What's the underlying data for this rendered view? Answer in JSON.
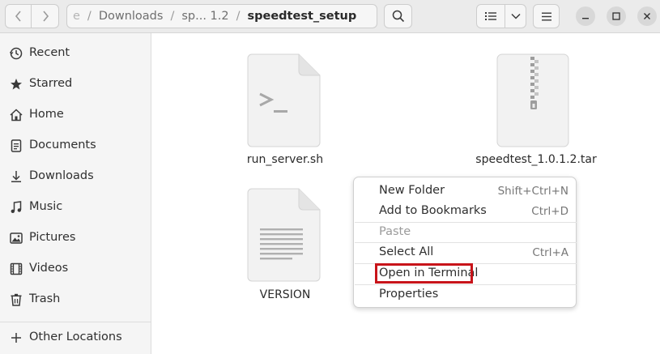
{
  "header": {
    "path": {
      "crumbs": [
        "e",
        "Downloads",
        "sp... 1.2",
        "speedtest_setup"
      ],
      "separator": "/"
    },
    "icons": {
      "back": "chevron-left-icon",
      "forward": "chevron-right-icon",
      "path_menu": "vertical-dots-icon",
      "search": "search-icon",
      "list_view": "list-view-icon",
      "view_options": "chevron-down-icon",
      "main_menu": "hamburger-menu-icon",
      "minimize": "minimize-icon",
      "maximize": "maximize-icon",
      "close": "close-icon"
    }
  },
  "sidebar": {
    "items": [
      {
        "label": "Recent",
        "icon": "clock-icon"
      },
      {
        "label": "Starred",
        "icon": "star-icon"
      },
      {
        "label": "Home",
        "icon": "home-icon"
      },
      {
        "label": "Documents",
        "icon": "document-icon"
      },
      {
        "label": "Downloads",
        "icon": "download-icon"
      },
      {
        "label": "Music",
        "icon": "music-note-icon"
      },
      {
        "label": "Pictures",
        "icon": "picture-icon"
      },
      {
        "label": "Videos",
        "icon": "film-icon"
      },
      {
        "label": "Trash",
        "icon": "trash-icon"
      }
    ],
    "other_locations": {
      "label": "Other Locations",
      "icon": "plus-icon"
    }
  },
  "files": [
    {
      "name": "run_server.sh",
      "icon": "shell-script-icon"
    },
    {
      "name": "speedtest_1.0.1.2.tar",
      "icon": "archive-icon"
    },
    {
      "name": "VERSION",
      "icon": "text-file-icon"
    }
  ],
  "context_menu": {
    "items": [
      {
        "label": "New Folder",
        "shortcut": "Shift+Ctrl+N"
      },
      {
        "label": "Add to Bookmarks",
        "shortcut": "Ctrl+D"
      },
      {
        "label": "Paste",
        "shortcut": "",
        "disabled": true
      },
      {
        "label": "Select All",
        "shortcut": "Ctrl+A"
      },
      {
        "label": "Open in Terminal",
        "shortcut": "",
        "highlighted": true
      },
      {
        "label": "Properties",
        "shortcut": ""
      }
    ]
  },
  "colors": {
    "highlight_box": "#c8141a",
    "header_bg": "#ebebeb",
    "sidebar_bg": "#f5f5f5"
  }
}
